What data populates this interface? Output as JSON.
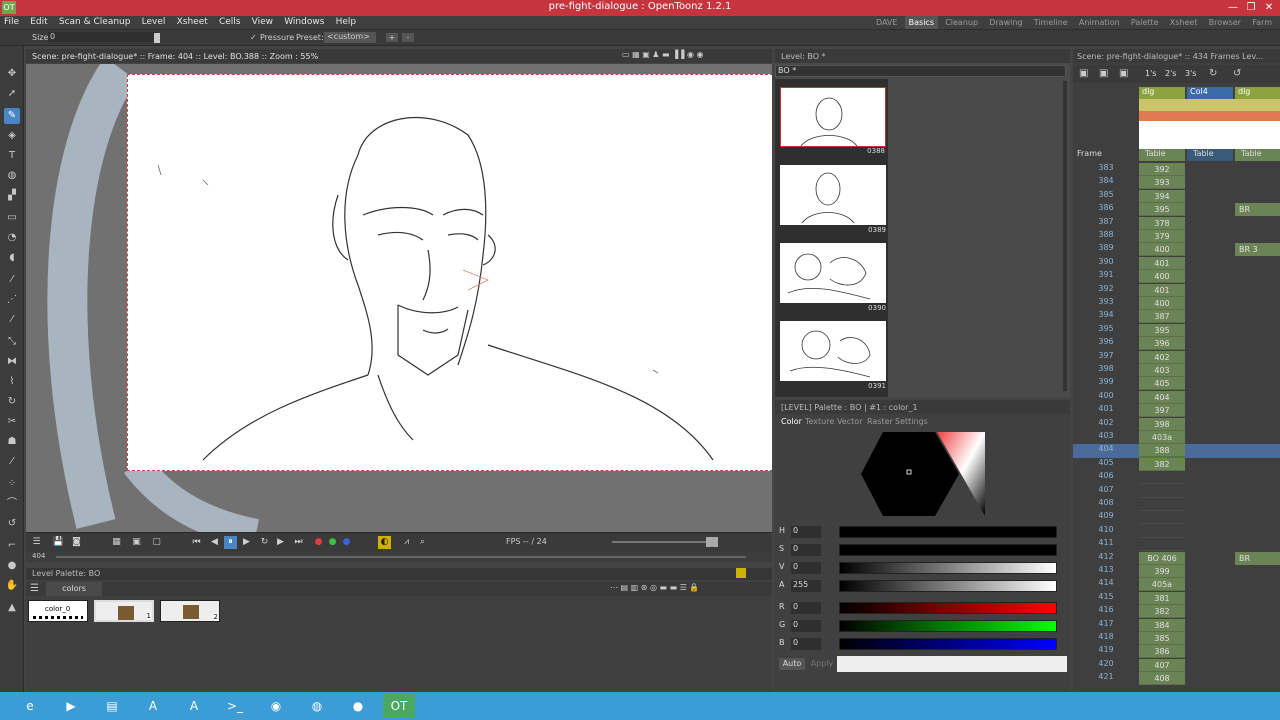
{
  "window": {
    "title": "pre-fight-dialogue : OpenToonz 1.2.1",
    "min": "—",
    "max": "❐",
    "close": "✕",
    "logo": "OT"
  },
  "menu": [
    "File",
    "Edit",
    "Scan & Cleanup",
    "Level",
    "Xsheet",
    "Cells",
    "View",
    "Windows",
    "Help"
  ],
  "rooms": [
    "DAVE",
    "Basics",
    "Cleanup",
    "Drawing",
    "Timeline",
    "Animation",
    "Palette",
    "Xsheet",
    "Browser",
    "Farm"
  ],
  "active_room": "Basics",
  "tool_options": {
    "size_label": "Size",
    "size_value": "0",
    "pressure": "Pressure",
    "preset_label": "Preset:",
    "preset_value": "<custom>",
    "plus": "+",
    "minus": "-"
  },
  "viewer": {
    "header": "Scene: pre-fight-dialogue*  ::  Frame: 404  ::  Level: BO.388  ::  Zoom : 55%",
    "fps": "FPS -- / 24",
    "frame": "404"
  },
  "level_palette": {
    "title": "Level Palette: BO",
    "tab": "colors",
    "chips": [
      "color_0",
      "1",
      "2"
    ]
  },
  "level_strip": {
    "title": "Level:  BO *",
    "name": "BO *",
    "frames": [
      "0388",
      "0389",
      "0390",
      "0391"
    ]
  },
  "style_editor": {
    "header": "[LEVEL]  Palette : BO | #1 : color_1",
    "tabs": [
      "Color",
      "Texture",
      "Vector",
      "Raster",
      "Settings"
    ],
    "channels": [
      {
        "label": "H",
        "value": "0"
      },
      {
        "label": "S",
        "value": "0"
      },
      {
        "label": "V",
        "value": "0"
      },
      {
        "label": "A",
        "value": "255"
      },
      {
        "label": "R",
        "value": "0"
      },
      {
        "label": "G",
        "value": "0"
      },
      {
        "label": "B",
        "value": "0"
      }
    ],
    "auto": "Auto",
    "apply": "Apply"
  },
  "xsheet": {
    "header": "Scene: pre-fight-dialogue*  ::  434 Frames  Lev...",
    "step_buttons": [
      "1's",
      "2's",
      "3's"
    ],
    "columns": [
      {
        "name": "dlg",
        "pegbar": "Table"
      },
      {
        "name": "Col4",
        "pegbar": "Table"
      },
      {
        "name": "dlg",
        "pegbar": "Table"
      }
    ],
    "frame_label": "Frame",
    "rows": [
      {
        "f": "383",
        "c1": "392",
        "c3": ""
      },
      {
        "f": "384",
        "c1": "393",
        "c3": ""
      },
      {
        "f": "385",
        "c1": "394",
        "c3": ""
      },
      {
        "f": "386",
        "c1": "395",
        "c3": "BR"
      },
      {
        "f": "387",
        "c1": "378",
        "c3": ""
      },
      {
        "f": "388",
        "c1": "379",
        "c3": ""
      },
      {
        "f": "389",
        "c1": "400",
        "c3": "BR   3"
      },
      {
        "f": "390",
        "c1": "401",
        "c3": ""
      },
      {
        "f": "391",
        "c1": "400",
        "c3": ""
      },
      {
        "f": "392",
        "c1": "401",
        "c3": ""
      },
      {
        "f": "393",
        "c1": "400",
        "c3": ""
      },
      {
        "f": "394",
        "c1": "387",
        "c3": ""
      },
      {
        "f": "395",
        "c1": "395",
        "c3": ""
      },
      {
        "f": "396",
        "c1": "396",
        "c3": ""
      },
      {
        "f": "397",
        "c1": "402",
        "c3": ""
      },
      {
        "f": "398",
        "c1": "403",
        "c3": ""
      },
      {
        "f": "399",
        "c1": "405",
        "c3": ""
      },
      {
        "f": "400",
        "c1": "404",
        "c3": ""
      },
      {
        "f": "401",
        "c1": "397",
        "c3": ""
      },
      {
        "f": "402",
        "c1": "398",
        "c3": ""
      },
      {
        "f": "403",
        "c1": "403a",
        "c3": ""
      },
      {
        "f": "404",
        "c1": "388",
        "c3": ""
      },
      {
        "f": "405",
        "c1": "382",
        "c3": ""
      },
      {
        "f": "406",
        "c1": "",
        "c3": ""
      },
      {
        "f": "407",
        "c1": "",
        "c3": ""
      },
      {
        "f": "408",
        "c1": "",
        "c3": ""
      },
      {
        "f": "409",
        "c1": "",
        "c3": ""
      },
      {
        "f": "410",
        "c1": "",
        "c3": ""
      },
      {
        "f": "411",
        "c1": "",
        "c3": ""
      },
      {
        "f": "412",
        "c1": "BO      406",
        "c3": "BR"
      },
      {
        "f": "413",
        "c1": "399",
        "c3": ""
      },
      {
        "f": "414",
        "c1": "405a",
        "c3": ""
      },
      {
        "f": "415",
        "c1": "381",
        "c3": ""
      },
      {
        "f": "416",
        "c1": "382",
        "c3": ""
      },
      {
        "f": "417",
        "c1": "384",
        "c3": ""
      },
      {
        "f": "418",
        "c1": "385",
        "c3": ""
      },
      {
        "f": "419",
        "c1": "386",
        "c3": ""
      },
      {
        "f": "420",
        "c1": "407",
        "c3": ""
      },
      {
        "f": "421",
        "c1": "408",
        "c3": ""
      }
    ],
    "current_frame": "404"
  },
  "taskbar": [
    {
      "name": "ie-icon",
      "glyph": "e"
    },
    {
      "name": "media-player-icon",
      "glyph": "▶"
    },
    {
      "name": "file-explorer-icon",
      "glyph": "▤"
    },
    {
      "name": "app-icon",
      "glyph": "A"
    },
    {
      "name": "app-icon-2",
      "glyph": "A"
    },
    {
      "name": "terminal-icon",
      "glyph": ">_"
    },
    {
      "name": "app-icon-3",
      "glyph": "◉"
    },
    {
      "name": "firefox-icon",
      "glyph": "◍"
    },
    {
      "name": "obs-icon",
      "glyph": "●"
    },
    {
      "name": "opentoonz-icon",
      "glyph": "OT"
    }
  ]
}
